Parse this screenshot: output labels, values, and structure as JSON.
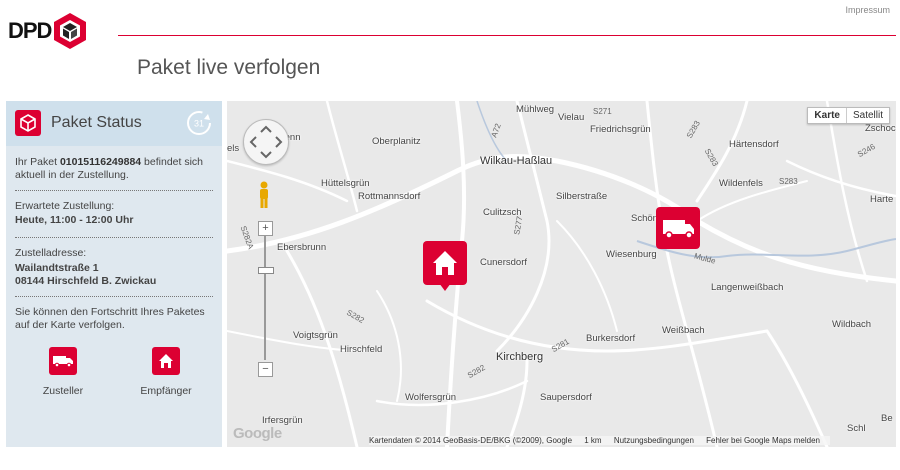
{
  "header": {
    "logo_text": "DPD",
    "impressum": "Impressum",
    "title": "Paket live verfolgen"
  },
  "status_panel": {
    "title": "Paket Status",
    "refresh_count": "31",
    "parcel_prefix": "Ihr Paket ",
    "parcel_number": "01015116249884",
    "parcel_suffix": " befindet sich aktuell in der Zustellung.",
    "delivery_label": "Erwartete Zustellung:",
    "delivery_time": "Heute, 11:00 - 12:00 Uhr",
    "address_label": "Zustelladresse:",
    "address_street": "Wailandtstraße 1",
    "address_city": "08144 Hirschfeld B. Zwickau",
    "track_hint": "Sie können den Fortschritt Ihres Paketes auf der Karte verfolgen.",
    "btn_courier": "Zusteller",
    "btn_recipient": "Empfänger"
  },
  "map": {
    "type_map": "Karte",
    "type_satellite": "Satellit",
    "zoom_in": "+",
    "zoom_out": "−",
    "logo": "Google",
    "attribution": "Kartendaten © 2014 GeoBasis-DE/BKG (©2009), Google",
    "scale": "1 km",
    "terms": "Nutzungsbedingungen",
    "report": "Fehler bei Google Maps melden",
    "places": {
      "muehlweg": "Mühlweg",
      "vielau": "Vielau",
      "friedrichsgruen": "Friedrichsgrün",
      "haertensdorf": "Härtensdorf",
      "zschocken": "Zschoc",
      "oberplanitz": "Oberplanitz",
      "wilkau": "Wilkau-Haßlau",
      "huettelsgruen": "Hüttelsgrün",
      "rottmannsdorf": "Rottmannsdorf",
      "silberstrasse": "Silberstraße",
      "wildenfels": "Wildenfels",
      "hartenstein": "Harte",
      "culitzsch": "Culitzsch",
      "schoenau": "Schön",
      "ebersbrunn": "Ebersbrunn",
      "cunersdorf": "Cunersdorf",
      "wiesenburg": "Wiesenburg",
      "mulde": "Mulde",
      "langenweissbach": "Langenweißbach",
      "weissbach": "Weißbach",
      "wildbach": "Wildbach",
      "voigtsgruen": "Voigtsgrün",
      "burkersdorf": "Burkersdorf",
      "hirschfeld": "Hirschfeld",
      "kirchberg": "Kirchberg",
      "wolfersgruen": "Wolfersgrün",
      "saupersdorf": "Saupersdorf",
      "irfersgruen": "Irfersgrün",
      "schl": "Schl",
      "be": "Be",
      "tenn": "tenn",
      "els": "els"
    },
    "roads": {
      "s271": "S271",
      "s283a": "S283",
      "s283b": "S283",
      "s246": "S246",
      "s277": "S277",
      "s282a": "S282A",
      "s282": "S282",
      "s281": "S281",
      "s282b": "S282",
      "a72": "A72"
    }
  }
}
